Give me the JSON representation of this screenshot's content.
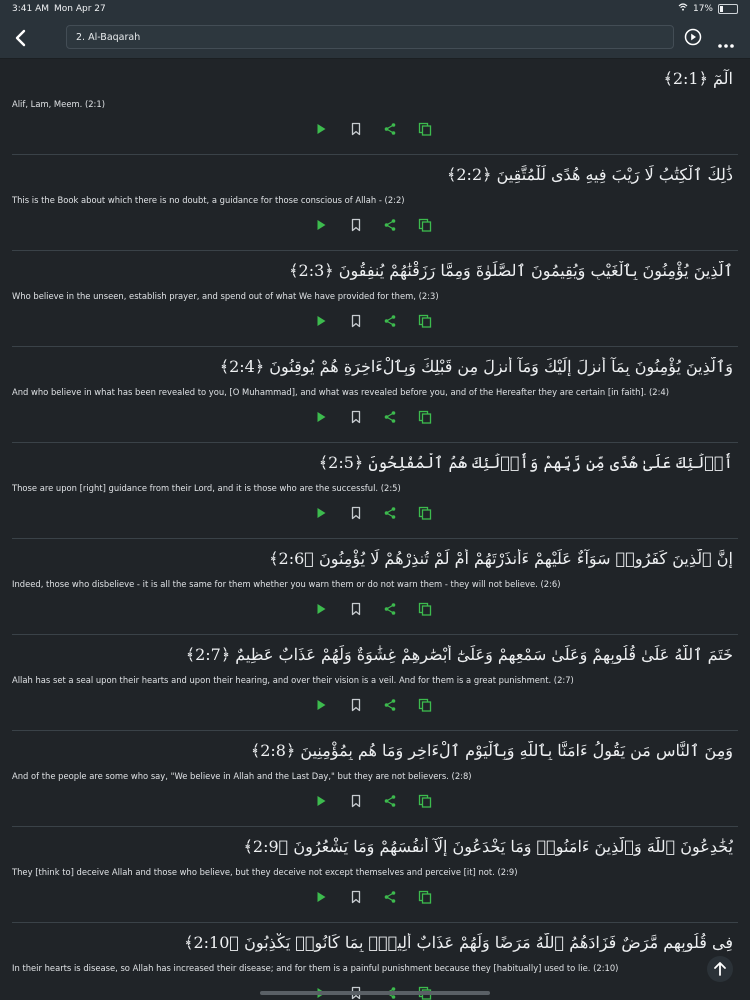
{
  "status_bar": {
    "time": "3:41 AM",
    "date": "Mon Apr 27",
    "battery": "17%",
    "wifi_icon": "wifi-icon",
    "battery_icon": "battery-icon"
  },
  "nav": {
    "title": "2. Al-Baqarah",
    "back_icon": "chevron-left-icon",
    "play_icon": "play-circle-icon",
    "more_icon": "more-horizontal-icon"
  },
  "colors": {
    "background": "#202428",
    "bar": "#2a333a",
    "accent_green": "#3dbb4e",
    "icon_grey": "#c7ccd0"
  },
  "ayahs": [
    {
      "arabic": "الٓمٓ ﴿2:1﴾",
      "translation": "Alif, Lam, Meem. (2:1)"
    },
    {
      "arabic": "ذَٰلِكَ ٱلْكِتَٰبُ لَا رَيْبَ فِيهِ هُدًى لِّلْمُتَّقِينَ ﴿2:2﴾",
      "translation": "This is the Book about which there is no doubt, a guidance for those conscious of Allah - (2:2)"
    },
    {
      "arabic": "ٱلَّذِينَ يُؤْمِنُونَ بِٱلْغَيْبِ وَيُقِيمُونَ ٱلصَّلَوٰةَ وَمِمَّا رَزَقْنَٰهُمْ يُنفِقُونَ ﴿2:3﴾",
      "translation": "Who believe in the unseen, establish prayer, and spend out of what We have provided for them, (2:3)"
    },
    {
      "arabic": "وَٱلَّذِينَ يُؤْمِنُونَ بِمَآ أُنزِلَ إِلَيْكَ وَمَآ أُنزِلَ مِن قَبْلِكَ وَبِٱلْءَاخِرَةِ هُمْ يُوقِنُونَ ﴿2:4﴾",
      "translation": "And who believe in what has been revealed to you, [O Muhammad], and what was revealed before you, and of the Hereafter they are certain [in faith]. (2:4)"
    },
    {
      "arabic": "أُو۟لَٰٓئِكَ عَلَىٰ هُدًى مِّن رَّبِّهِمْ وَأُو۟لَٰٓئِكَ هُمُ ٱلْمُفْلِحُونَ ﴿2:5﴾",
      "translation": "Those are upon [right] guidance from their Lord, and it is those who are the successful. (2:5)"
    },
    {
      "arabic": "إِنَّ ٱلَّذِينَ كَفَرُوا۟ سَوَآءٌ عَلَيْهِمْ ءَأَنذَرْتَهُمْ أَمْ لَمْ تُنذِرْهُمْ لَا يُؤْمِنُونَ ﴿2:6﴾",
      "translation": "Indeed, those who disbelieve - it is all the same for them whether you warn them or do not warn them - they will not believe. (2:6)"
    },
    {
      "arabic": "خَتَمَ ٱللَّهُ عَلَىٰ قُلُوبِهِمْ وَعَلَىٰ سَمْعِهِمْ وَعَلَىٰٓ أَبْصَٰرِهِمْ غِشَٰوَةٌ وَلَهُمْ عَذَابٌ عَظِيمٌ ﴿2:7﴾",
      "translation": "Allah has set a seal upon their hearts and upon their hearing, and over their vision is a veil. And for them is a great punishment. (2:7)"
    },
    {
      "arabic": "وَمِنَ ٱلنَّاسِ مَن يَقُولُ ءَامَنَّا بِٱللَّهِ وَبِٱلْيَوْمِ ٱلْءَاخِرِ وَمَا هُم بِمُؤْمِنِينَ ﴿2:8﴾",
      "translation": "And of the people are some who say, \"We believe in Allah and the Last Day,\" but they are not believers. (2:8)"
    },
    {
      "arabic": "يُخَٰدِعُونَ ٱللَّهَ وَٱلَّذِينَ ءَامَنُوا۟ وَمَا يَخْدَعُونَ إِلَّآ أَنفُسَهُمْ وَمَا يَشْعُرُونَ ﴿2:9﴾",
      "translation": "They [think to] deceive Allah and those who believe, but they deceive not except themselves and perceive [it] not. (2:9)"
    },
    {
      "arabic": "فِى قُلُوبِهِم مَّرَضٌ فَزَادَهُمُ ٱللَّهُ مَرَضًا وَلَهُمْ عَذَابٌ أَلِيمٌۢ بِمَا كَانُوا۟ يَكْذِبُونَ ﴿2:10﴾",
      "translation": "In their hearts is disease, so Allah has increased their disease; and for them is a painful punishment because they [habitually] used to lie. (2:10)"
    }
  ],
  "ayah_action_icons": [
    "play-icon",
    "bookmark-icon",
    "share-icon",
    "copy-icon"
  ],
  "scroll_top_icon": "arrow-up-icon"
}
